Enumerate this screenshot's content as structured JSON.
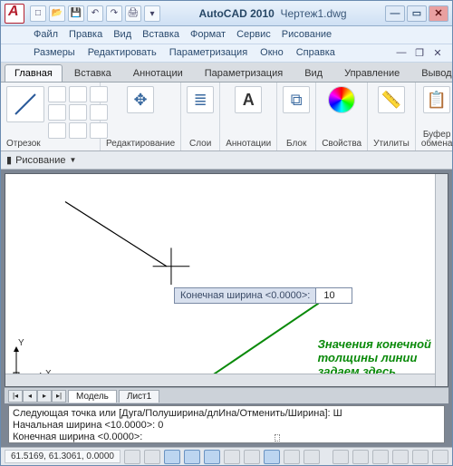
{
  "app": {
    "name": "AutoCAD 2010",
    "document": "Чертеж1.dwg"
  },
  "qat": [
    "new",
    "open",
    "save",
    "undo",
    "redo",
    "print"
  ],
  "menu1": [
    "Файл",
    "Правка",
    "Вид",
    "Вставка",
    "Формат",
    "Сервис",
    "Рисование"
  ],
  "menu2": [
    "Размеры",
    "Редактировать",
    "Параметризация",
    "Окно",
    "Справка"
  ],
  "ribbon_tabs": [
    "Главная",
    "Вставка",
    "Аннотации",
    "Параметризация",
    "Вид",
    "Управление",
    "Вывод"
  ],
  "ribbon_active": 0,
  "panels": {
    "line": "Отрезок",
    "edit": "Редактирование",
    "layers": "Слои",
    "annot": "Аннотации",
    "block": "Блок",
    "props": "Свойства",
    "utils": "Утилиты",
    "clip": "Буфер обмена"
  },
  "ribbon_drop": "Рисование",
  "tooltip": {
    "label": "Конечная ширина <0.0000>:",
    "value": "10"
  },
  "annotation": [
    "Значения конечной",
    "толщины линии",
    "задаем здесь"
  ],
  "axes": {
    "y": "Y",
    "x": "X"
  },
  "model_tabs": {
    "model": "Модель",
    "sheet1": "Лист1"
  },
  "cmdline": {
    "l1": "Следующая точка или [Дуга/Полуширина/длИна/Отменить/Ширина]: Ш",
    "l2": "Начальная ширина <10.0000>: 0",
    "l3": "Конечная ширина <0.0000>:"
  },
  "status": {
    "coords": "61.5169, 61.3061, 0.0000"
  }
}
